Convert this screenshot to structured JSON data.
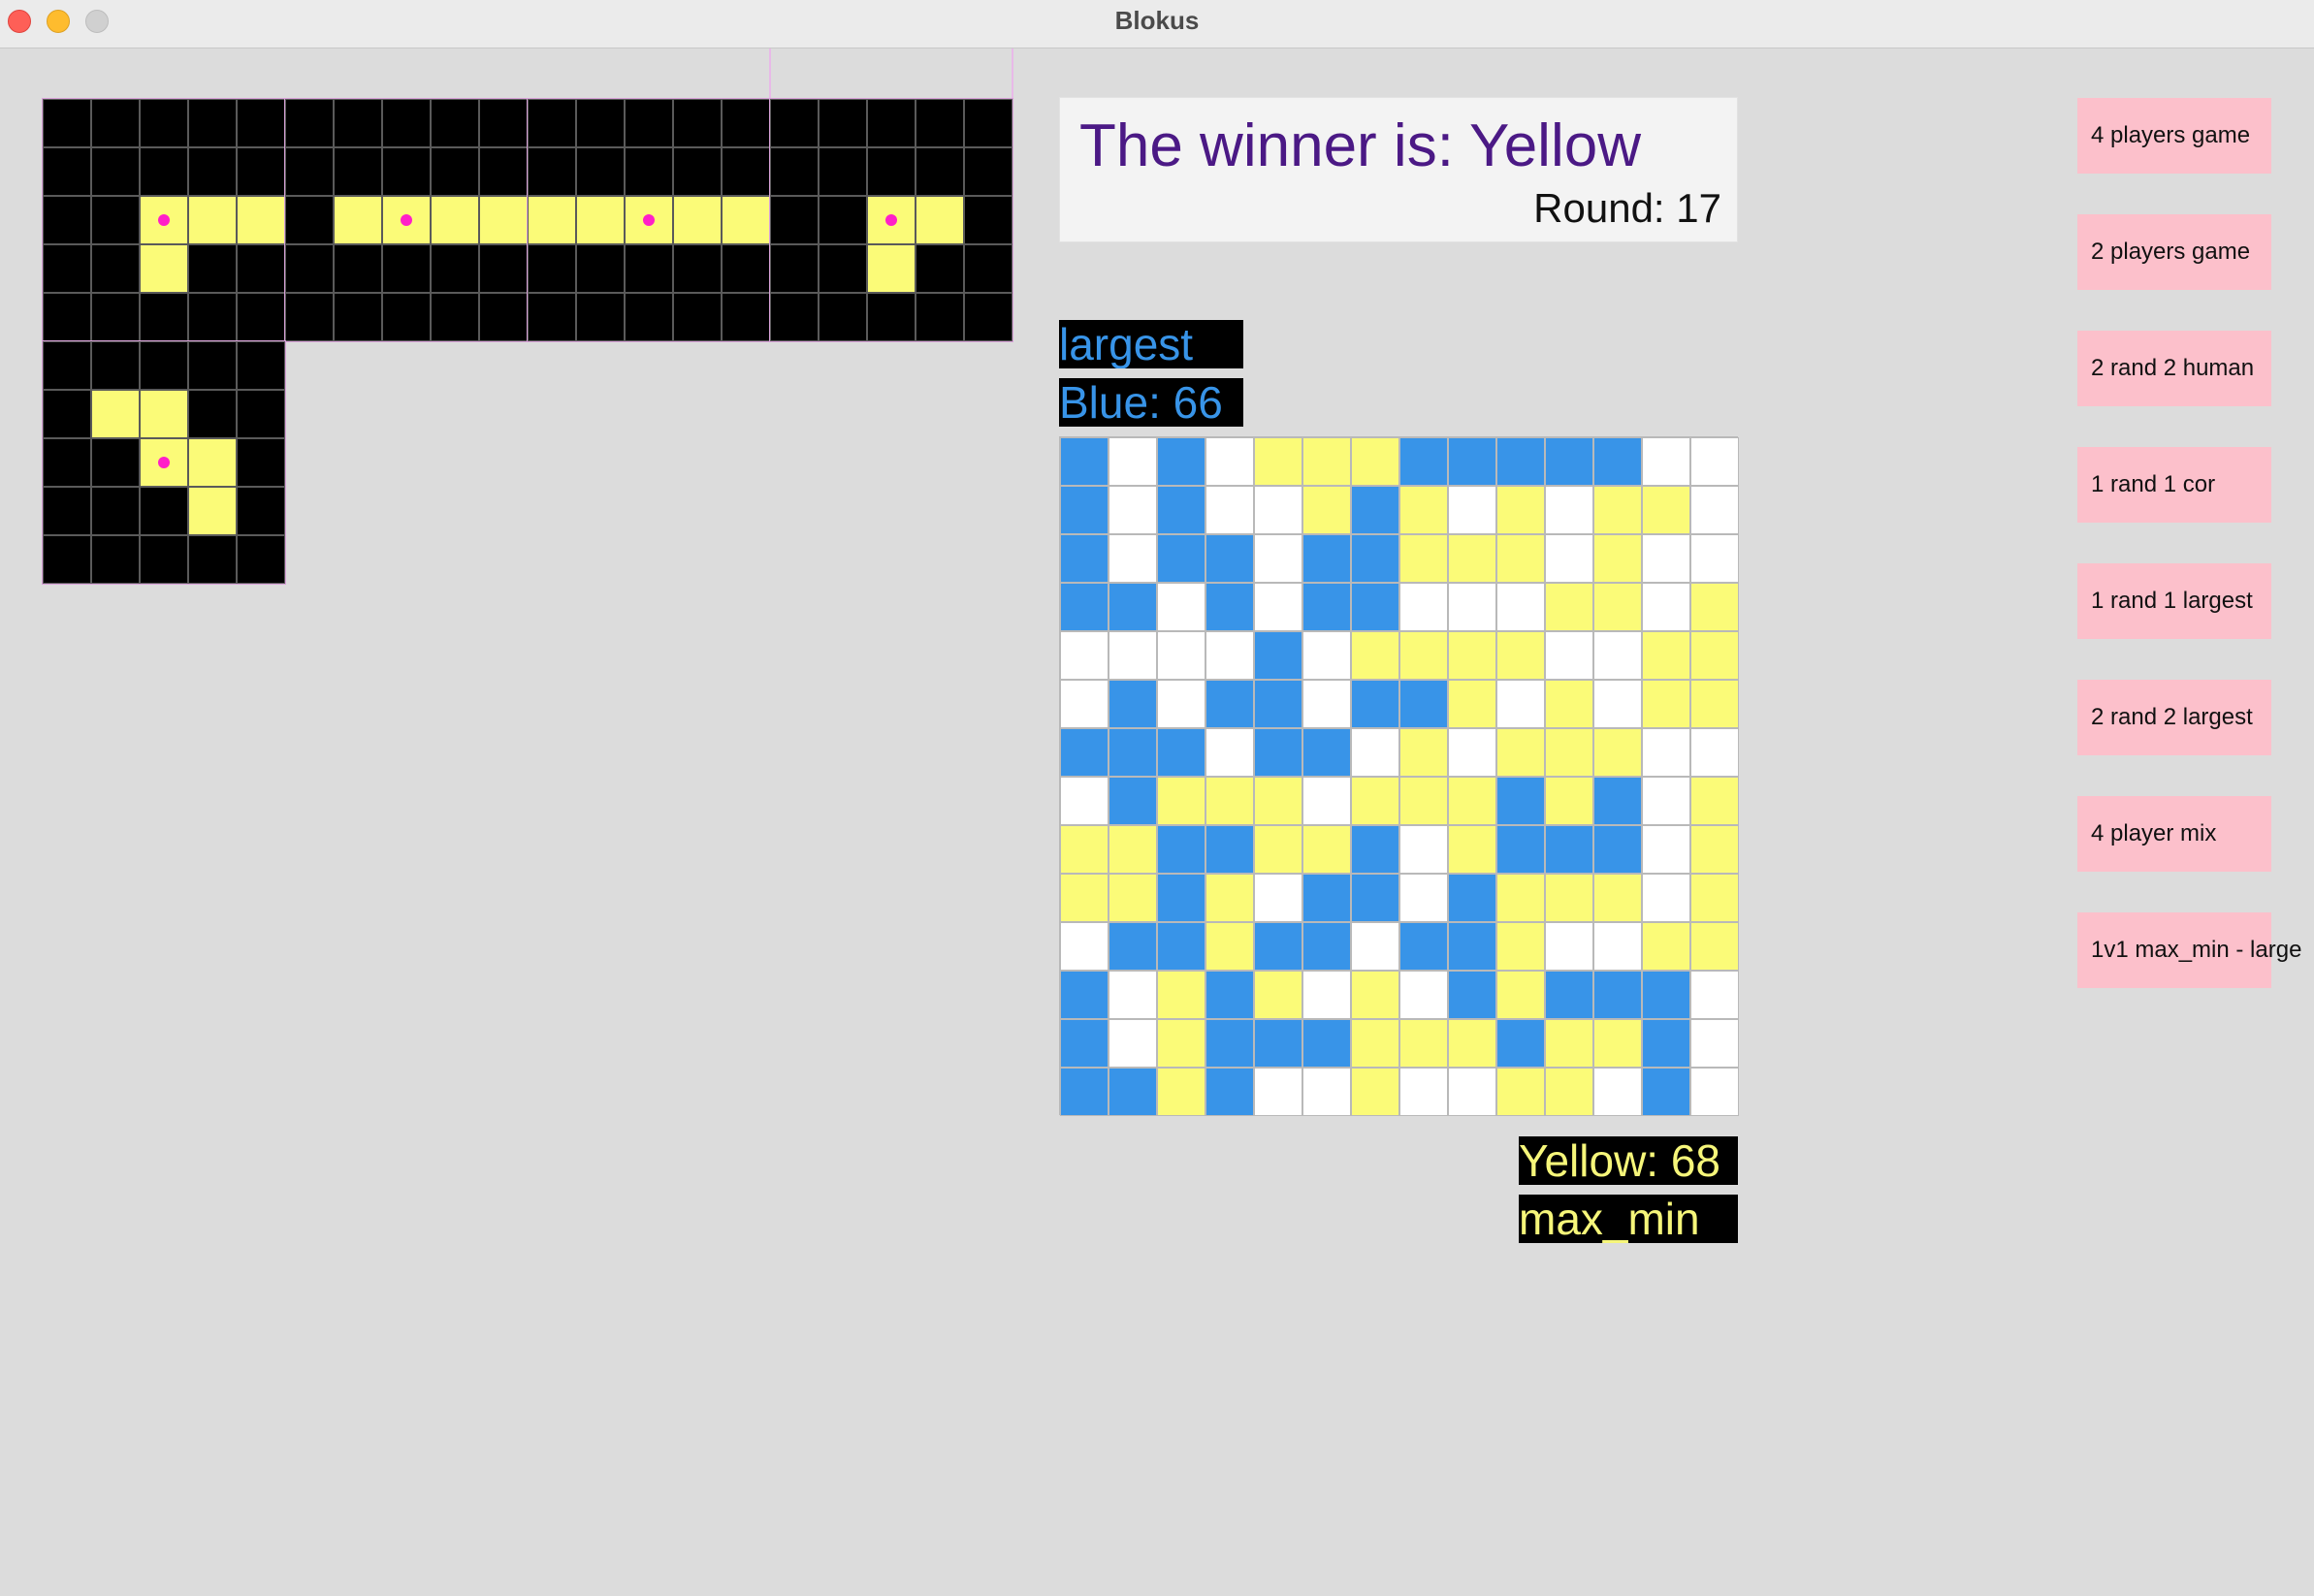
{
  "window": {
    "title": "Blokus",
    "controls": [
      "close",
      "minimize",
      "maximize"
    ]
  },
  "colors": {
    "background": "#dcdcdc",
    "tray_background": "#000000",
    "piece_yellow": "#fbfb78",
    "piece_blue": "#3894e8",
    "empty_cell": "#ffffff",
    "anchor_dot": "#ff1fc8",
    "winner_text": "#4b1985",
    "button_pink": "#fcc0cb"
  },
  "pieces_tray": {
    "trays": [
      {
        "cells": [
          [
            2,
            2
          ],
          [
            2,
            3
          ],
          [
            2,
            4
          ],
          [
            3,
            2
          ]
        ],
        "anchor": [
          2,
          2
        ]
      },
      {
        "cells": [
          [
            2,
            1
          ],
          [
            2,
            2
          ],
          [
            2,
            3
          ],
          [
            2,
            4
          ]
        ],
        "anchor": [
          2,
          2
        ]
      },
      {
        "cells": [
          [
            2,
            0
          ],
          [
            2,
            1
          ],
          [
            2,
            2
          ],
          [
            2,
            3
          ],
          [
            2,
            4
          ]
        ],
        "anchor": [
          2,
          2
        ]
      },
      {
        "cells": [
          [
            2,
            2
          ],
          [
            2,
            3
          ],
          [
            3,
            2
          ]
        ],
        "anchor": [
          2,
          2
        ]
      },
      {
        "cells": [
          [
            1,
            1
          ],
          [
            1,
            2
          ],
          [
            2,
            2
          ],
          [
            2,
            3
          ],
          [
            3,
            3
          ]
        ],
        "anchor": [
          2,
          2
        ]
      }
    ]
  },
  "status": {
    "winner_text": "The winner is: Yellow",
    "round_text": "Round:  17"
  },
  "players": {
    "blue": {
      "strategy": "largest",
      "score_text": "Blue: 66"
    },
    "yellow": {
      "strategy": "max_min",
      "score_text": "Yellow: 68"
    }
  },
  "board": {
    "size": 14,
    "rows": [
      "BWBWYYYBBBBBWW",
      "BWBWWYBYWYWYYW",
      "BWBBWBBYYYWYWW",
      "BBWBWBBWWWYYWY",
      "WWWWBWYYYYWWYY",
      "WBWBBWBBYWYWYY",
      "BBBWBBWYWYYYWW",
      "WBYYYWYYYBYBWY",
      "YYBBYYBWYBBBWY",
      "YYBYWBBWBYYYWY",
      "WBBYBBWBBYWWYY",
      "BWYBYWYWBYBBBW",
      "BWYBBBYYYBYYBW",
      "BBYBWWYWWYYWBW"
    ]
  },
  "game_modes": [
    "4 players game",
    "2 players game",
    "2 rand 2 human",
    "1 rand 1 cor",
    "1 rand 1 largest",
    "2 rand 2 largest",
    "4 player mix",
    "1v1 max_min - large"
  ]
}
